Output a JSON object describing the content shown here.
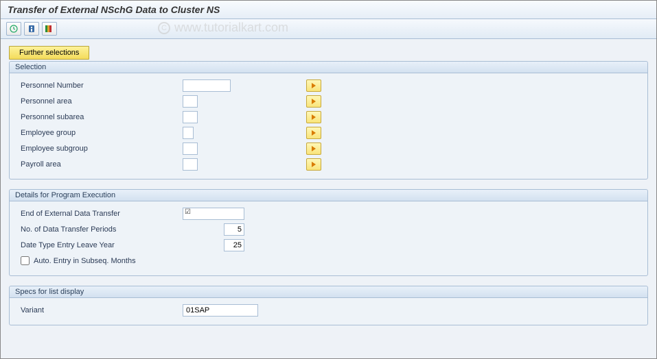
{
  "title": "Transfer of External NSchG Data to Cluster NS",
  "watermark": "www.tutorialkart.com",
  "toolbar": {
    "execute": "execute",
    "info": "info",
    "variant": "variant"
  },
  "further_selections_label": "Further selections",
  "groups": {
    "selection": {
      "title": "Selection",
      "rows": [
        {
          "label": "Personnel Number",
          "value": "",
          "width": "med"
        },
        {
          "label": "Personnel area",
          "value": "",
          "width": "narrow"
        },
        {
          "label": "Personnel subarea",
          "value": "",
          "width": "narrow"
        },
        {
          "label": "Employee group",
          "value": "",
          "width": "narrow"
        },
        {
          "label": "Employee subgroup",
          "value": "",
          "width": "narrow"
        },
        {
          "label": "Payroll area",
          "value": "",
          "width": "narrow"
        }
      ]
    },
    "details": {
      "title": "Details for Program Execution",
      "end_label": "End of External Data Transfer",
      "end_value": "",
      "periods_label": "No. of Data Transfer Periods",
      "periods_value": "5",
      "date_type_label": "Date Type Entry Leave Year",
      "date_type_value": "25",
      "auto_entry_label": "Auto. Entry in Subseq. Months",
      "auto_entry_checked": false
    },
    "specs": {
      "title": "Specs for list display",
      "variant_label": "Variant",
      "variant_value": "01SAP"
    }
  }
}
